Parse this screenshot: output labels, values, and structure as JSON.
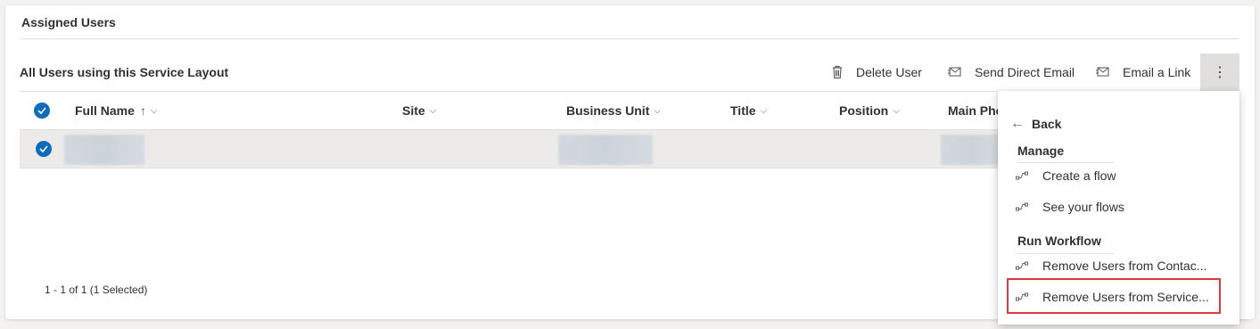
{
  "section": {
    "title": "Assigned Users"
  },
  "subgrid": {
    "title": "All Users using this Service Layout"
  },
  "commands": {
    "delete_user": "Delete User",
    "send_direct_email": "Send Direct Email",
    "email_a_link": "Email a Link",
    "more": "⋮"
  },
  "columns": [
    "Full Name",
    "Site",
    "Business Unit",
    "Title",
    "Position",
    "Main Pho"
  ],
  "sort_indicator": "↑",
  "footer": {
    "count": "1 - 1 of 1 (1 Selected)"
  },
  "menu": {
    "back": "Back",
    "manage_heading": "Manage",
    "manage_items": [
      "Create a flow",
      "See your flows"
    ],
    "workflow_heading": "Run Workflow",
    "workflow_items": [
      "Remove Users from Contac...",
      "Remove Users from Service..."
    ]
  },
  "colors": {
    "accent": "#0f6cbd",
    "highlight": "#e0393e",
    "selected_row": "#edebe9"
  },
  "icons": {
    "delete": "trash-icon",
    "email": "email-icon",
    "link": "email-link-icon",
    "flow": "flow-icon",
    "back": "back-arrow-icon"
  }
}
